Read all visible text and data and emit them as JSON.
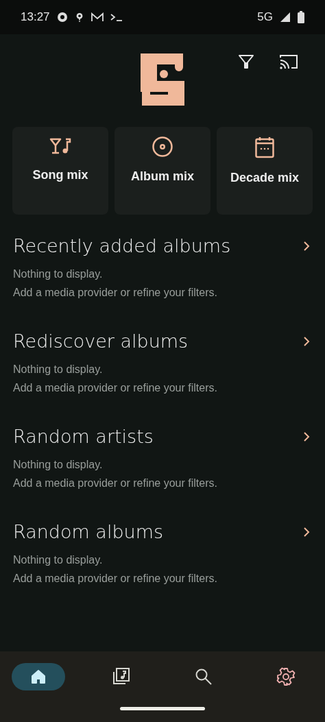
{
  "status_bar": {
    "time": "13:27",
    "network": "5G"
  },
  "mixes": [
    {
      "kind": "song",
      "label": "Song mix"
    },
    {
      "kind": "album",
      "label": "Album mix"
    },
    {
      "kind": "decade",
      "label": "Decade mix"
    }
  ],
  "sections": [
    {
      "title": "Recently added albums",
      "empty_lines": [
        "Nothing to display.",
        "Add a media provider or refine your filters."
      ]
    },
    {
      "title": "Rediscover albums",
      "empty_lines": [
        "Nothing to display.",
        "Add a media provider or refine your filters."
      ]
    },
    {
      "title": "Random artists",
      "empty_lines": [
        "Nothing to display.",
        "Add a media provider or refine your filters."
      ]
    },
    {
      "title": "Random albums",
      "empty_lines": [
        "Nothing to display.",
        "Add a media provider or refine your filters."
      ]
    }
  ],
  "bottom_nav": [
    {
      "kind": "home",
      "selected": true
    },
    {
      "kind": "library",
      "selected": false
    },
    {
      "kind": "search",
      "selected": false
    },
    {
      "kind": "settings",
      "selected": false
    }
  ]
}
